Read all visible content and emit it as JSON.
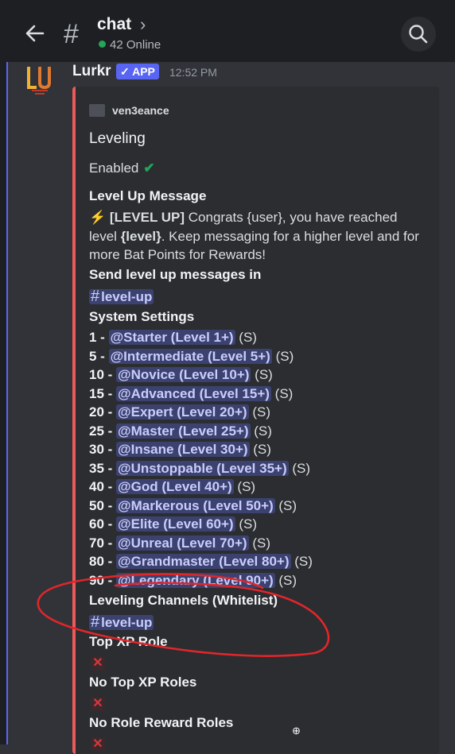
{
  "header": {
    "channel": "chat",
    "online": "42 Online"
  },
  "message": {
    "author": "Lurkr",
    "badge": "✓ APP",
    "time": "12:52 PM",
    "embed": {
      "author": "ven3eance",
      "title": "Leveling",
      "enabled": "Enabled",
      "levelup_name": "Level Up Message",
      "levelup_head": "[LEVEL UP]",
      "levelup_l1": " Congrats {user}, you have reached",
      "levelup_l2a": "level ",
      "levelup_l2b": "{level}",
      "levelup_l2c": ". Keep messaging for a higher level and for",
      "levelup_l3": "more Bat Points for Rewards!",
      "send_name": "Send level up messages in",
      "channel_pill": "level-up",
      "system_name": "System Settings",
      "roles": [
        {
          "level": "1 - ",
          "role": "@Starter (Level 1+)",
          "suffix": " (S)"
        },
        {
          "level": "5 - ",
          "role": "@Intermediate (Level 5+)",
          "suffix": " (S)"
        },
        {
          "level": "10 - ",
          "role": "@Novice (Level 10+)",
          "suffix": " (S)"
        },
        {
          "level": "15 - ",
          "role": "@Advanced (Level 15+)",
          "suffix": " (S)"
        },
        {
          "level": "20 - ",
          "role": "@Expert (Level 20+)",
          "suffix": " (S)"
        },
        {
          "level": "25 - ",
          "role": "@Master (Level 25+)",
          "suffix": " (S)"
        },
        {
          "level": "30 - ",
          "role": "@Insane (Level 30+)",
          "suffix": " (S)"
        },
        {
          "level": "35 - ",
          "role": "@Unstoppable (Level 35+)",
          "suffix": " (S)"
        },
        {
          "level": "40 - ",
          "role": "@God (Level 40+)",
          "suffix": " (S)"
        },
        {
          "level": "50 - ",
          "role": "@Markerous (Level 50+)",
          "suffix": " (S)"
        },
        {
          "level": "60 - ",
          "role": "@Elite (Level 60+)",
          "suffix": " (S)"
        },
        {
          "level": "70 - ",
          "role": "@Unreal (Level 70+)",
          "suffix": " (S)"
        },
        {
          "level": "80 - ",
          "role": "@Grandmaster (Level 80+)",
          "suffix": " (S)"
        },
        {
          "level": "90 - ",
          "role": "@Legendary (Level 90+)",
          "suffix": " (S)"
        }
      ],
      "whitelist_name": "Leveling Channels (Whitelist)",
      "whitelist_pill": "level-up",
      "topxp_name": "Top XP Role",
      "no_topxp_name": "No Top XP Roles",
      "no_reward_name": "No Role Reward Roles",
      "x_mark": "✕"
    }
  },
  "colors": {
    "embed_accent": "#ed5a5a",
    "annotation": "#e0262b",
    "mention_bg": "#3c4270"
  }
}
